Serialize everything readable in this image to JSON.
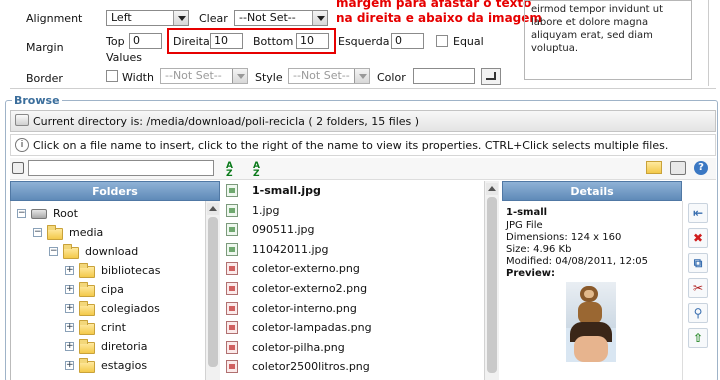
{
  "hint": {
    "line1": "margem para afastar o texto",
    "line2": "na direita e abaixo da imagem"
  },
  "props": {
    "alignment_label": "Alignment",
    "alignment_value": "Left",
    "clear_label": "Clear",
    "clear_value": "--Not Set--",
    "margin_label": "Margin",
    "top_label": "Top",
    "top_value": "0",
    "right_label": "Direita",
    "right_value": "10",
    "bottom_label": "Bottom",
    "bottom_value": "10",
    "left_label": "Esquerda",
    "left_value": "0",
    "equal_label": "Equal",
    "values_label": "Values",
    "border_label": "Border",
    "width_label": "Width",
    "width_value": "--Not Set--",
    "style_label": "Style",
    "style_value": "--Not Set--",
    "color_label": "Color",
    "color_value": ""
  },
  "preview_text": "eirmod tempor invidunt ut labore et dolore magna aliquyam erat, sed diam voluptua.",
  "browse": {
    "legend": "Browse",
    "current_dir": "Current directory is: /media/download/poli-recicla ( 2 folders, 15 files )",
    "help": "Click on a file name to insert, click to the right of the name to view its properties. CTRL+Click selects multiple files.",
    "search_value": ""
  },
  "folders": {
    "title": "Folders",
    "items": [
      {
        "label": "Root",
        "expander": "−",
        "kind": "drive"
      },
      {
        "label": "media",
        "expander": "−",
        "kind": "folder"
      },
      {
        "label": "download",
        "expander": "−",
        "kind": "folder"
      },
      {
        "label": "bibliotecas",
        "expander": "+",
        "kind": "folder"
      },
      {
        "label": "cipa",
        "expander": "+",
        "kind": "folder"
      },
      {
        "label": "colegiados",
        "expander": "+",
        "kind": "folder"
      },
      {
        "label": "crint",
        "expander": "+",
        "kind": "folder"
      },
      {
        "label": "diretoria",
        "expander": "+",
        "kind": "folder"
      },
      {
        "label": "estagios",
        "expander": "+",
        "kind": "folder"
      }
    ]
  },
  "files": [
    {
      "name": "1-small.jpg",
      "type": "jpg",
      "selected": true
    },
    {
      "name": "1.jpg",
      "type": "jpg",
      "selected": false
    },
    {
      "name": "090511.jpg",
      "type": "jpg",
      "selected": false
    },
    {
      "name": "11042011.jpg",
      "type": "jpg",
      "selected": false
    },
    {
      "name": "coletor-externo.png",
      "type": "png",
      "selected": false
    },
    {
      "name": "coletor-externo2.png",
      "type": "png",
      "selected": false
    },
    {
      "name": "coletor-interno.png",
      "type": "png",
      "selected": false
    },
    {
      "name": "coletor-lampadas.png",
      "type": "png",
      "selected": false
    },
    {
      "name": "coletor-pilha.png",
      "type": "png",
      "selected": false
    },
    {
      "name": "coletor2500litros.png",
      "type": "png",
      "selected": false
    }
  ],
  "details": {
    "title": "Details",
    "name": "1-small",
    "type": "JPG File",
    "dimensions": "Dimensions: 124 x 160",
    "size": "Size: 4.96 Kb",
    "modified": "Modified: 04/08/2011, 12:05",
    "preview": "Preview:"
  },
  "colors": {
    "hint_red": "#e60000",
    "panel_blue": "#6f97c2",
    "legend_blue": "#3b6e9c"
  }
}
